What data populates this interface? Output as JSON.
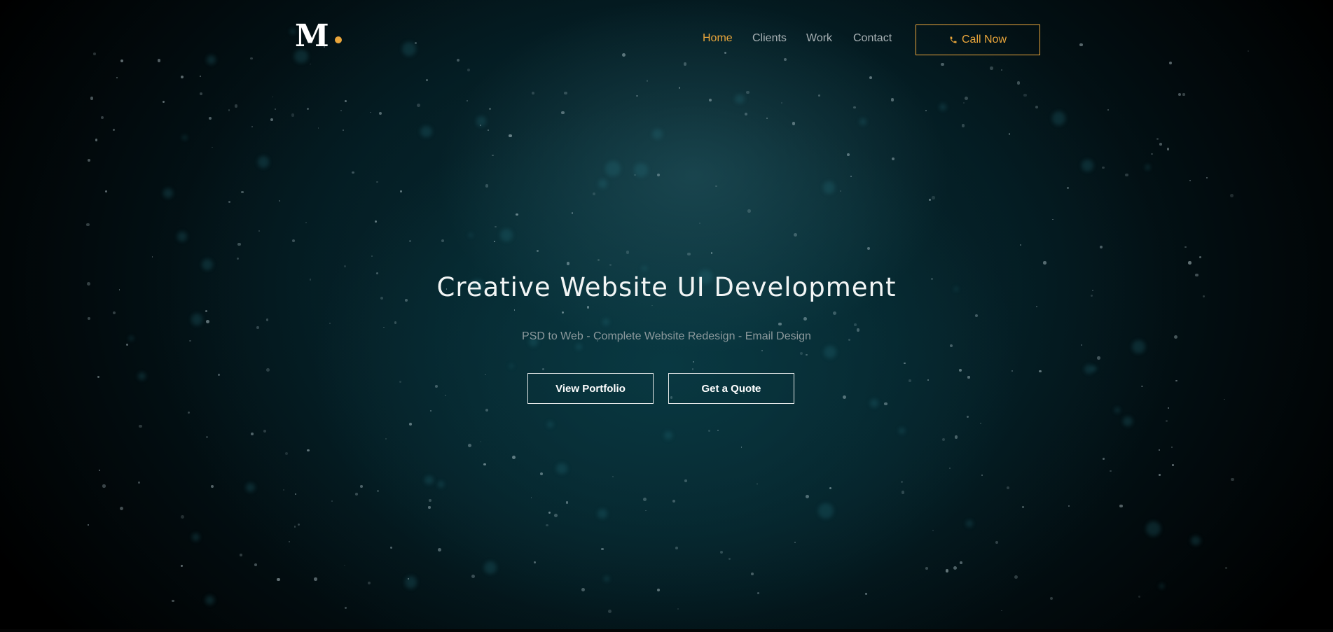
{
  "brand": {
    "logo_letter": "M",
    "accent_color": "#e9a53b"
  },
  "nav": {
    "items": [
      {
        "label": "Home",
        "active": true
      },
      {
        "label": "Clients",
        "active": false
      },
      {
        "label": "Work",
        "active": false
      },
      {
        "label": "Contact",
        "active": false
      }
    ],
    "cta": {
      "label": "Call Now",
      "icon": "phone-icon"
    }
  },
  "hero": {
    "title": "Creative Website UI Development",
    "subtitle": "PSD to Web - Complete Website Redesign - Email Design",
    "buttons": [
      {
        "label": "View Portfolio"
      },
      {
        "label": "Get a Quote"
      }
    ],
    "background": "starfield-teal"
  }
}
